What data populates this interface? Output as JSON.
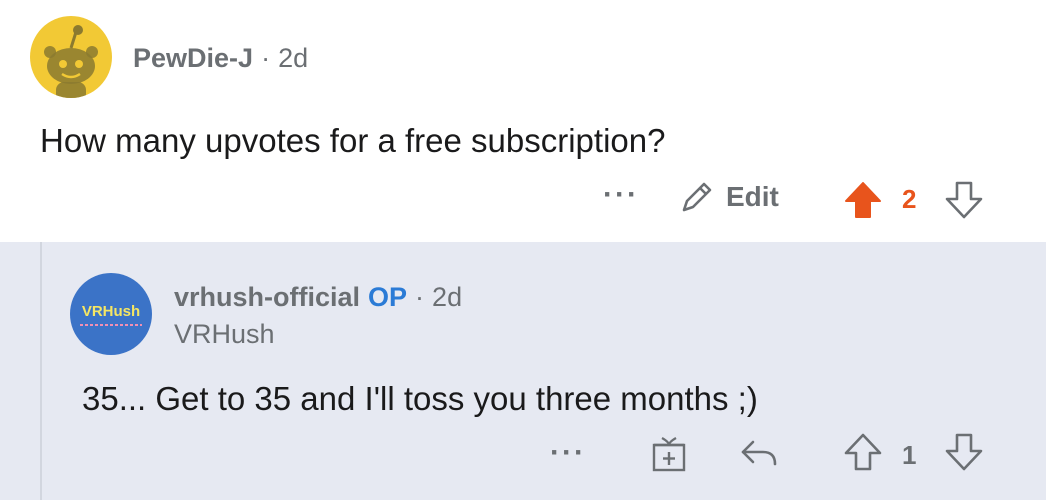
{
  "parent_comment": {
    "author": "PewDie-J",
    "time": "2d",
    "body": "How many upvotes for a free subscription?",
    "actions": {
      "more_label": "···",
      "edit_label": "Edit",
      "vote_count": "2",
      "upvoted": true
    }
  },
  "reply_comment": {
    "author": "vrhush-official",
    "op_badge": "OP",
    "time": "2d",
    "flair": "VRHush",
    "body": "35... Get to 35 and I'll toss you three months ;)",
    "avatar_logo_text": "VRHush",
    "actions": {
      "more_label": "···",
      "vote_count": "1",
      "upvoted": false
    }
  },
  "colors": {
    "upvote_active": "#e8541c",
    "op_badge": "#2b7bd6",
    "meta_text": "#6b6f73",
    "reply_background": "#e6e9f2",
    "avatar_top": "#f2c935",
    "avatar_reply": "#3b73c7"
  },
  "icons": {
    "snoo_avatar": "snoo-avatar-icon",
    "edit": "pencil-icon",
    "upvote": "upvote-arrow-icon",
    "downvote": "downvote-arrow-icon",
    "award": "gift-icon",
    "reply": "reply-arrow-icon"
  }
}
